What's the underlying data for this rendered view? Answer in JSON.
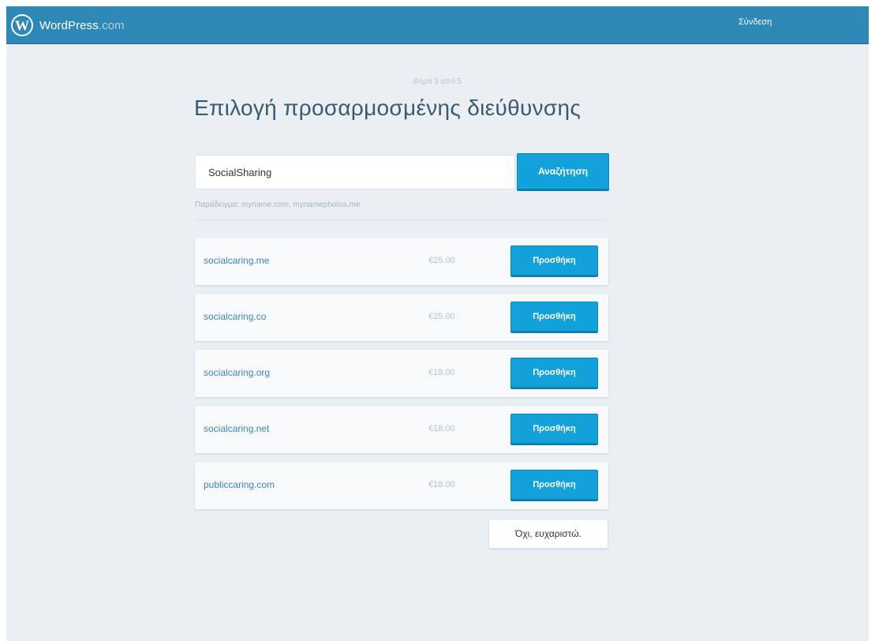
{
  "masthead": {
    "brand_name": "WordPress",
    "brand_suffix": ".com",
    "login_label": "Σύνδεση",
    "colors": {
      "bar": "#2e88b6",
      "text": "#ffffff"
    }
  },
  "signup": {
    "step_label": "Βήμα 3 από 5",
    "title": "Επιλογή προσαρμοσμένης διεύθυνσης",
    "search": {
      "value": "SocialSharing",
      "button_label": "Αναζήτηση"
    },
    "example_text": "Παράδειγμα: myname.com, mynamephotos.me",
    "results": [
      {
        "domain": "socialcaring.me",
        "price": "€25.00",
        "button_label": "Προσθήκη"
      },
      {
        "domain": "socialcaring.co",
        "price": "€25.00",
        "button_label": "Προσθήκη"
      },
      {
        "domain": "socialcaring.org",
        "price": "€18.00",
        "button_label": "Προσθήκη"
      },
      {
        "domain": "socialcaring.net",
        "price": "€18.00",
        "button_label": "Προσθήκη"
      },
      {
        "domain": "publiccaring.com",
        "price": "€18.00",
        "button_label": "Προσθήκη"
      }
    ],
    "skip_label": "Όχι, ευχαριστώ."
  },
  "colors": {
    "background": "#e9eff3",
    "accent": "#12a2d9",
    "link": "#3f87b1"
  },
  "icons": {
    "logo": "wordpress-logo-icon"
  }
}
